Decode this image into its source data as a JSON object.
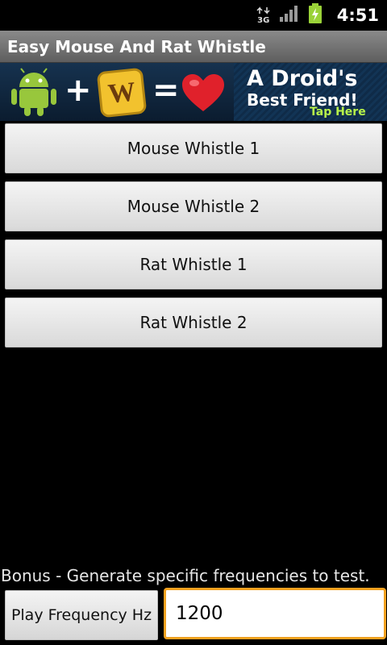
{
  "status_bar": {
    "network_label": "3G",
    "time": "4:51"
  },
  "app": {
    "title": "Easy Mouse And Rat Whistle"
  },
  "ad": {
    "line1": "A Droid's",
    "line2": "Best Friend!",
    "cta": "Tap Here",
    "plus": "+",
    "equals": "=",
    "tile_letter": "W",
    "colors": {
      "android_green": "#98c73c",
      "tile_yellow": "#f2c22e",
      "heart_red": "#e0212b",
      "cta_green": "#b7f24a"
    }
  },
  "buttons": [
    {
      "label": "Mouse Whistle 1"
    },
    {
      "label": "Mouse Whistle 2"
    },
    {
      "label": "Rat Whistle 1"
    },
    {
      "label": "Rat Whistle 2"
    }
  ],
  "bonus": {
    "text": "Bonus - Generate specific frequencies to test.",
    "play_label": "Play Frequency Hz",
    "frequency_value": "1200"
  }
}
